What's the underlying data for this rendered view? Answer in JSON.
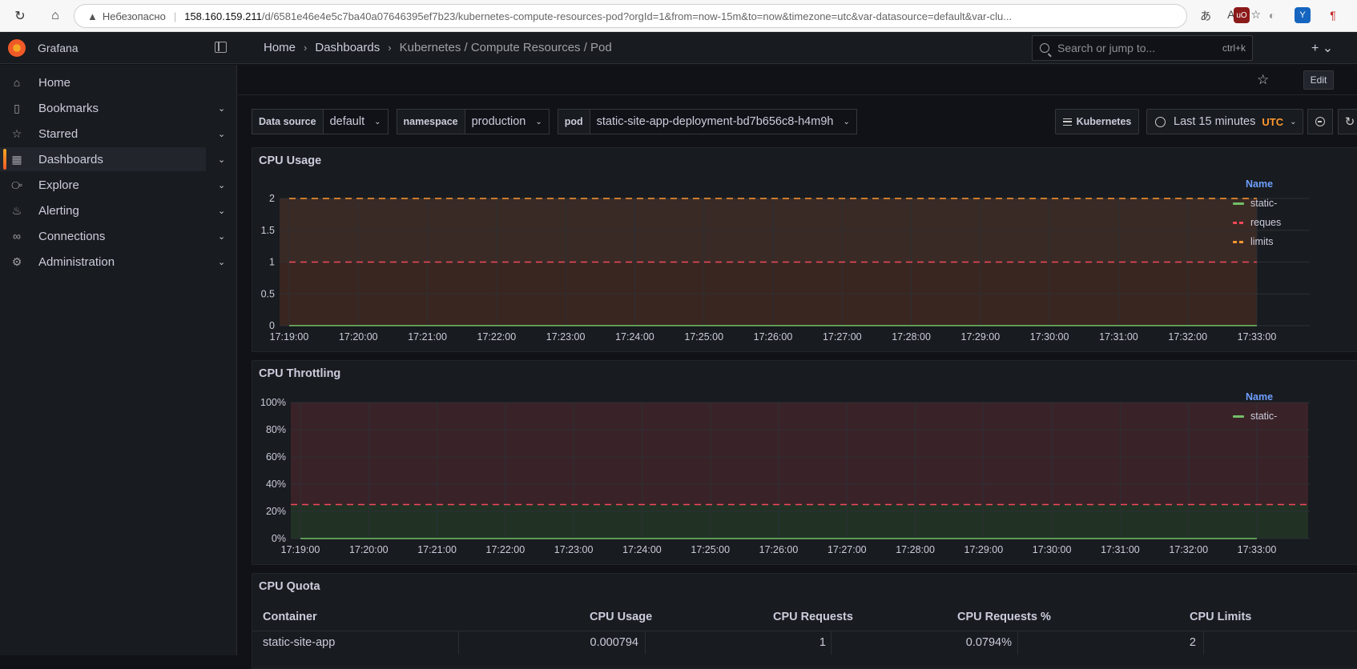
{
  "browser": {
    "insecure_label": "Небезопасно",
    "url_host": "158.160.159.211",
    "url_path": "/d/6581e46e4e5c7ba40a07646395ef7b23/kubernetes-compute-resources-pod?orgId=1&from=now-15m&to=now&timezone=utc&var-datasource=default&var-clu..."
  },
  "app": {
    "brand": "Grafana",
    "search_placeholder": "Search or jump to...",
    "search_shortcut": "ctrl+k"
  },
  "breadcrumbs": [
    "Home",
    "Dashboards",
    "Kubernetes / Compute Resources / Pod"
  ],
  "sidebar": {
    "items": [
      {
        "label": "Home",
        "icon": "home-icon",
        "chevron": false
      },
      {
        "label": "Bookmarks",
        "icon": "bookmark-icon",
        "chevron": true
      },
      {
        "label": "Starred",
        "icon": "star-icon",
        "chevron": true
      },
      {
        "label": "Dashboards",
        "icon": "dashboards-icon",
        "chevron": true,
        "active": true
      },
      {
        "label": "Explore",
        "icon": "compass-icon",
        "chevron": true
      },
      {
        "label": "Alerting",
        "icon": "bell-icon",
        "chevron": true
      },
      {
        "label": "Connections",
        "icon": "connections-icon",
        "chevron": true
      },
      {
        "label": "Administration",
        "icon": "gear-icon",
        "chevron": true
      }
    ]
  },
  "toolbar": {
    "edit_label": "Edit"
  },
  "variables": {
    "datasource": {
      "label": "Data source",
      "value": "default"
    },
    "namespace": {
      "label": "namespace",
      "value": "production"
    },
    "pod": {
      "label": "pod",
      "value": "static-site-app-deployment-bd7b656c8-h4m9h"
    }
  },
  "controls": {
    "kubernetes_label": "Kubernetes",
    "time_range": "Last 15 minutes",
    "timezone": "UTC"
  },
  "colors": {
    "accent_orange": "#ff9830",
    "green": "#73bf69",
    "red": "#f2495c",
    "yellow": "#ff9830",
    "legend_link": "#6e9fff"
  },
  "panels": {
    "cpu_usage": {
      "title": "CPU Usage",
      "legend_header": "Name",
      "legend": [
        {
          "label": "static-",
          "color": "#73bf69",
          "style": "solid"
        },
        {
          "label": "reques",
          "color": "#f2495c",
          "style": "dashed"
        },
        {
          "label": "limits",
          "color": "#ff9830",
          "style": "dashed"
        }
      ]
    },
    "cpu_throttling": {
      "title": "CPU Throttling",
      "legend_header": "Name",
      "legend": [
        {
          "label": "static-",
          "color": "#73bf69",
          "style": "solid"
        }
      ]
    },
    "cpu_quota": {
      "title": "CPU Quota",
      "columns": [
        "Container",
        "CPU Usage",
        "CPU Requests",
        "CPU Requests %",
        "CPU Limits"
      ],
      "rows": [
        [
          "static-site-app",
          "0.000794",
          "1",
          "0.0794%",
          "2"
        ]
      ]
    }
  },
  "chart_data": [
    {
      "type": "line",
      "title": "CPU Usage",
      "x": [
        "17:19:00",
        "17:20:00",
        "17:21:00",
        "17:22:00",
        "17:23:00",
        "17:24:00",
        "17:25:00",
        "17:26:00",
        "17:27:00",
        "17:28:00",
        "17:29:00",
        "17:30:00",
        "17:31:00",
        "17:32:00",
        "17:33:00"
      ],
      "ylim": [
        0,
        2
      ],
      "yticks": [
        "0",
        "0.5",
        "1",
        "1.5",
        "2"
      ],
      "series": [
        {
          "name": "static-",
          "values": [
            0.0008,
            0.0008,
            0.0008,
            0.0008,
            0.0008,
            0.0008,
            0.0008,
            0.0008,
            0.0008,
            0.0008,
            0.0008,
            0.0008,
            0.0008,
            0.0008,
            0.0008
          ]
        },
        {
          "name": "reques",
          "values": [
            1,
            1,
            1,
            1,
            1,
            1,
            1,
            1,
            1,
            1,
            1,
            1,
            1,
            1,
            1
          ]
        },
        {
          "name": "limits",
          "values": [
            2,
            2,
            2,
            2,
            2,
            2,
            2,
            2,
            2,
            2,
            2,
            2,
            2,
            2,
            2
          ]
        }
      ],
      "grid": true,
      "legend": "right"
    },
    {
      "type": "line",
      "title": "CPU Throttling",
      "x": [
        "17:19:00",
        "17:20:00",
        "17:21:00",
        "17:22:00",
        "17:23:00",
        "17:24:00",
        "17:25:00",
        "17:26:00",
        "17:27:00",
        "17:28:00",
        "17:29:00",
        "17:30:00",
        "17:31:00",
        "17:32:00",
        "17:33:00"
      ],
      "ylim": [
        0,
        100
      ],
      "yticks": [
        "0%",
        "20%",
        "40%",
        "60%",
        "80%",
        "100%"
      ],
      "threshold": 25,
      "series": [
        {
          "name": "static-",
          "values": [
            0,
            0,
            0,
            0,
            0,
            0,
            0,
            0,
            0,
            0,
            0,
            0,
            0,
            0,
            0
          ]
        }
      ],
      "grid": true,
      "legend": "right"
    }
  ]
}
